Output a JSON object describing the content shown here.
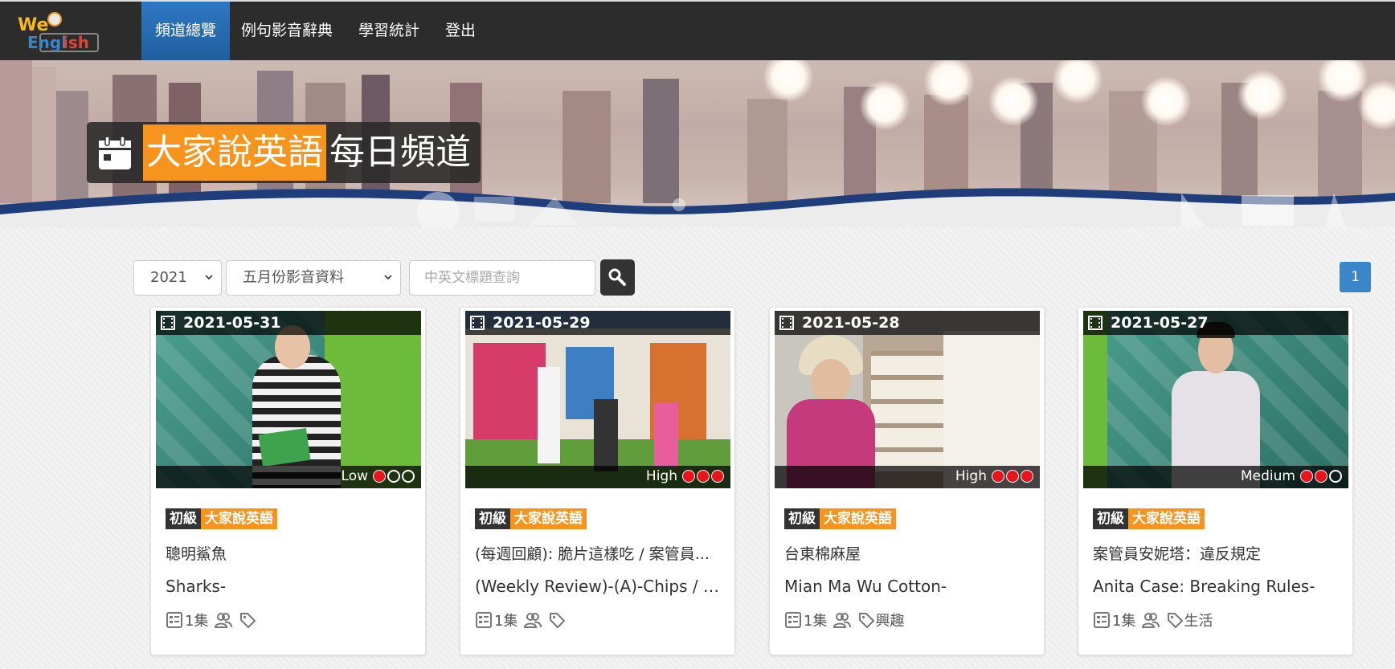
{
  "nav": {
    "logo_text": "WebEnglish",
    "items": [
      {
        "label": "頻道總覽",
        "active": true
      },
      {
        "label": "例句影音辭典",
        "active": false
      },
      {
        "label": "學習統計",
        "active": false
      },
      {
        "label": "登出",
        "active": false
      }
    ]
  },
  "banner": {
    "title_highlight": "大家說英語",
    "title_rest": "每日頻道",
    "icon": "calendar-icon",
    "accent_color": "#f7941d"
  },
  "filters": {
    "year": "2021",
    "month": "五月份影音資料",
    "search_placeholder": "中英文標題查詢",
    "search_icon": "search-icon"
  },
  "pagination": {
    "current": "1"
  },
  "cards": [
    {
      "date": "2021-05-31",
      "level_label": "Low",
      "level": 1,
      "tag_level": "初級",
      "tag_series": "大家說英語",
      "title_zh": "聰明鯊魚",
      "title_en": "Sharks-",
      "episodes": "1集",
      "category": ""
    },
    {
      "date": "2021-05-29",
      "level_label": "High",
      "level": 3,
      "tag_level": "初級",
      "tag_series": "大家說英語",
      "title_zh": "(每週回顧): 脆片這樣吃 / 案管員...",
      "title_en": "(Weekly Review)-(A)-Chips / A...",
      "episodes": "1集",
      "category": ""
    },
    {
      "date": "2021-05-28",
      "level_label": "High",
      "level": 3,
      "tag_level": "初級",
      "tag_series": "大家說英語",
      "title_zh": "台東棉麻屋",
      "title_en": "Mian Ma Wu Cotton-",
      "episodes": "1集",
      "category": "興趣"
    },
    {
      "date": "2021-05-27",
      "level_label": "Medium",
      "level": 2,
      "tag_level": "初級",
      "tag_series": "大家說英語",
      "title_zh": "案管員安妮塔：違反規定",
      "title_en": "Anita Case: Breaking Rules-",
      "episodes": "1集",
      "category": "生活"
    }
  ]
}
